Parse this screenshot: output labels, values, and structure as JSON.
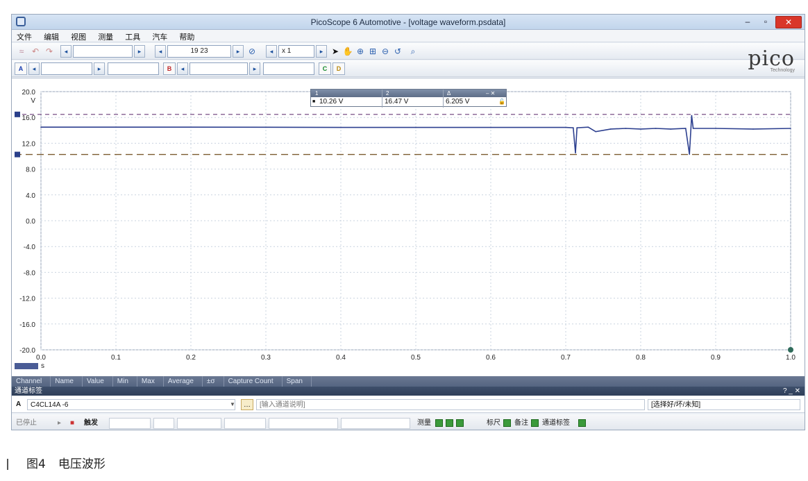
{
  "window": {
    "title": "PicoScope 6 Automotive - [voltage waveform.psdata]",
    "min_glyph": "–",
    "max_glyph": "▫",
    "close_glyph": "✕"
  },
  "menu": [
    "文件",
    "编辑",
    "视图",
    "测量",
    "工具",
    "汽车",
    "帮助"
  ],
  "toolbar1": {
    "timebase_value": "19 23",
    "zoom_value": "x 1"
  },
  "toolbar2": {
    "channel_a": "A",
    "channel_b": "B",
    "channel_c": "C",
    "channel_d": "D"
  },
  "logo": {
    "word": "pico",
    "sub": "Technology"
  },
  "ruler_window": {
    "headers": [
      "1",
      "2",
      "Δ"
    ],
    "values": [
      "10.26 V",
      "16.47 V",
      "6.205 V"
    ],
    "close_glyph": "– ✕"
  },
  "chart_data": {
    "type": "line",
    "title": "",
    "xlabel": "s",
    "ylabel": "V",
    "xlim": [
      0.0,
      1.0
    ],
    "ylim": [
      -20.0,
      20.0
    ],
    "grid": true,
    "x_ticks": [
      "0.0",
      "0.1",
      "0.2",
      "0.3",
      "0.4",
      "0.5",
      "0.6",
      "0.7",
      "0.8",
      "0.9",
      "1.0"
    ],
    "y_ticks": [
      "20.0",
      "16.0",
      "12.0",
      "8.0",
      "4.0",
      "0.0",
      "-4.0",
      "-8.0",
      "-12.0",
      "-16.0",
      "-20.0"
    ],
    "ruler_levels": {
      "upper": 16.47,
      "lower": 10.26
    },
    "series": [
      {
        "color": "#2c3f8f",
        "x": [
          0.0,
          0.1,
          0.2,
          0.3,
          0.4,
          0.5,
          0.6,
          0.7,
          0.71,
          0.713,
          0.715,
          0.73,
          0.74,
          0.76,
          0.78,
          0.8,
          0.82,
          0.84,
          0.86,
          0.865,
          0.868,
          0.87,
          0.9,
          0.95,
          1.0
        ],
        "y": [
          14.5,
          14.5,
          14.5,
          14.48,
          14.45,
          14.45,
          14.45,
          14.45,
          14.4,
          10.5,
          14.4,
          14.5,
          13.8,
          14.2,
          14.3,
          14.2,
          14.3,
          14.2,
          14.3,
          10.3,
          16.3,
          14.3,
          14.3,
          14.2,
          14.3
        ]
      }
    ]
  },
  "measurement_columns": [
    "Channel",
    "Name",
    "Value",
    "Min",
    "Max",
    "Average",
    "±σ",
    "Capture Count",
    "Span"
  ],
  "channel_labels_panel": {
    "title": "通道标签",
    "controls": "? _ ✕",
    "channel": "A",
    "name": "C4CL14A -6",
    "placeholder": "[输入通道说明]",
    "status_select": "[选择好/坏/未知]"
  },
  "statusbar": {
    "stop_label": "已停止",
    "trigger_label": "触发",
    "measure_label": "测量",
    "ruler_label": "标尺",
    "notes_label": "备注",
    "channel_label_label": "通道标签"
  },
  "caption": {
    "figure": "图4",
    "text": "电压波形"
  }
}
